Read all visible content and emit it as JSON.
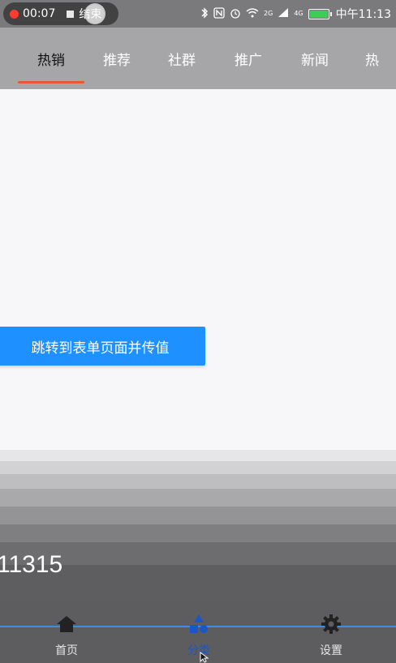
{
  "status_bar": {
    "record_time": "00:07",
    "record_end_label": "结束",
    "network_labels": [
      "2G",
      "4G"
    ],
    "clock": "中午11:13",
    "icons": [
      "bluetooth-icon",
      "nfc-icon",
      "alarm-icon",
      "wifi-icon",
      "signal-icon",
      "battery-icon"
    ]
  },
  "tabs": [
    {
      "label": "热销",
      "active": true
    },
    {
      "label": "推荐",
      "active": false
    },
    {
      "label": "社群",
      "active": false
    },
    {
      "label": "推广",
      "active": false
    },
    {
      "label": "新闻",
      "active": false
    },
    {
      "label": "热",
      "active": false
    }
  ],
  "main": {
    "jump_button_label": "跳转到表单页面并传值"
  },
  "overlay_number": "11315",
  "bottom_nav": [
    {
      "label": "首页",
      "icon": "home-icon",
      "active": false
    },
    {
      "label": "分类",
      "icon": "category-icon",
      "active": true
    },
    {
      "label": "设置",
      "icon": "gear-icon",
      "active": false
    }
  ],
  "colors": {
    "accent_blue": "#1e90ff",
    "tab_underline": "#e9573a",
    "active_nav": "#1a56c8"
  }
}
